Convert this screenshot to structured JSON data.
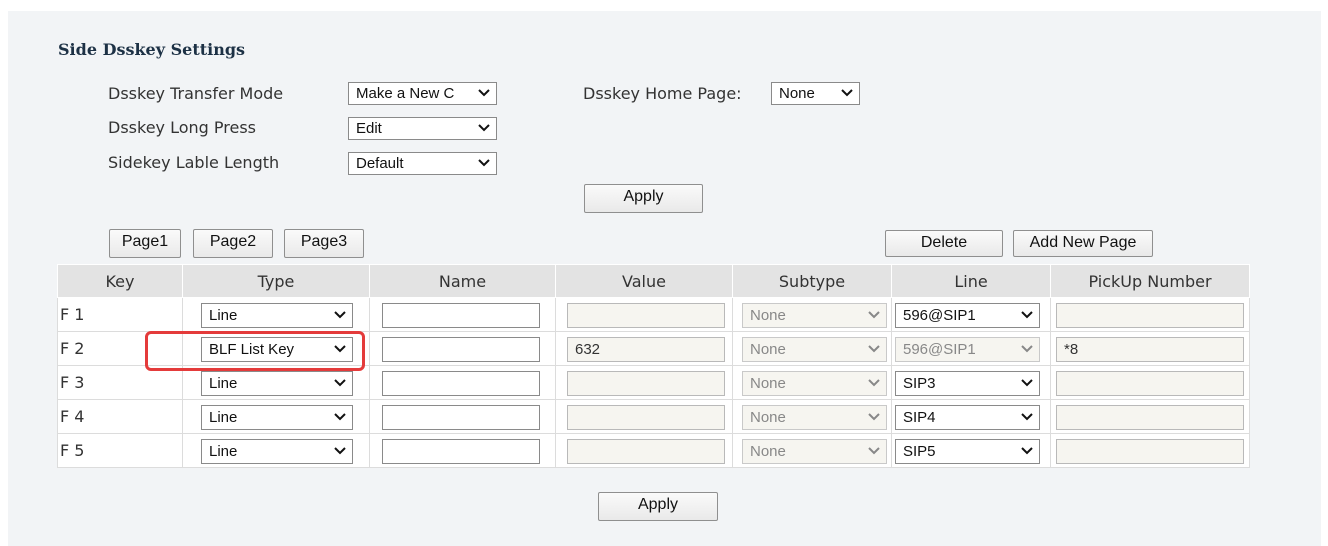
{
  "section_title": "Side Dsskey Settings",
  "settings": {
    "transfer_mode": {
      "label": "Dsskey Transfer Mode",
      "value": "Make a New C"
    },
    "long_press": {
      "label": "Dsskey Long Press",
      "value": "Edit"
    },
    "label_length": {
      "label": "Sidekey Lable Length",
      "value": "Default"
    },
    "home_page": {
      "label": "Dsskey Home Page:",
      "value": "None"
    },
    "apply_label": "Apply"
  },
  "pages": {
    "tabs": [
      "Page1",
      "Page2",
      "Page3"
    ],
    "delete_label": "Delete",
    "add_page_label": "Add New Page"
  },
  "table": {
    "headers": [
      "Key",
      "Type",
      "Name",
      "Value",
      "Subtype",
      "Line",
      "PickUp Number"
    ],
    "rows": [
      {
        "key": "F 1",
        "type": "Line",
        "name": "",
        "value": "",
        "subtype": "None",
        "line": "596@SIP1",
        "line_disabled": false,
        "pickup": ""
      },
      {
        "key": "F 2",
        "type": "BLF List Key",
        "name": "",
        "value": "632",
        "subtype": "None",
        "line": "596@SIP1",
        "line_disabled": true,
        "pickup": "*8"
      },
      {
        "key": "F 3",
        "type": "Line",
        "name": "",
        "value": "",
        "subtype": "None",
        "line": "SIP3",
        "line_disabled": false,
        "pickup": ""
      },
      {
        "key": "F 4",
        "type": "Line",
        "name": "",
        "value": "",
        "subtype": "None",
        "line": "SIP4",
        "line_disabled": false,
        "pickup": ""
      },
      {
        "key": "F 5",
        "type": "Line",
        "name": "",
        "value": "",
        "subtype": "None",
        "line": "SIP5",
        "line_disabled": false,
        "pickup": ""
      }
    ]
  },
  "bottom_apply_label": "Apply",
  "colors": {
    "panel_bg": "#f2f4f6",
    "header_bg": "#e3e3e3",
    "highlight": "#e43b3b",
    "disabled_field": "#f6f5f0"
  },
  "icons": {
    "dropdown": "chevron-down-icon",
    "highlight": "red-highlight-box"
  }
}
